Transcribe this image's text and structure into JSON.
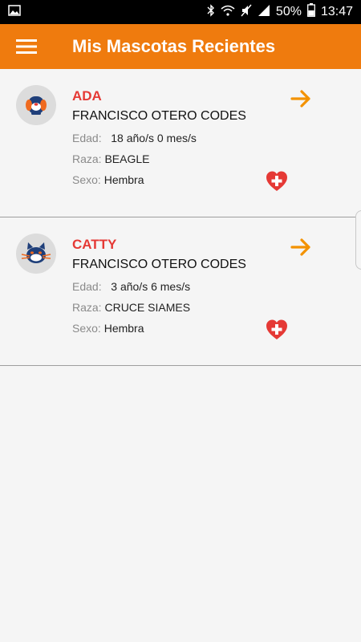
{
  "status_bar": {
    "battery_percent": "50%",
    "time": "13:47",
    "icons": [
      "image-icon",
      "bluetooth-icon",
      "wifi-icon",
      "mute-icon",
      "signal-icon",
      "battery-icon"
    ]
  },
  "app_bar": {
    "title": "Mis Mascotas Recientes",
    "menu_icon": "hamburger-menu-icon",
    "color": "#ef7b0e"
  },
  "labels": {
    "edad": "Edad:",
    "raza": "Raza:",
    "sexo": "Sexo:"
  },
  "pets": [
    {
      "name": "ADA",
      "owner": "FRANCISCO OTERO CODES",
      "edad": "18 año/s 0 mes/s",
      "raza": "BEAGLE",
      "sexo": "Hembra",
      "avatar_icon": "dog-icon"
    },
    {
      "name": "CATTY",
      "owner": "FRANCISCO OTERO CODES",
      "edad": "3 año/s 6 mes/s",
      "raza": "CRUCE SIAMES",
      "sexo": "Hembra",
      "avatar_icon": "cat-icon"
    }
  ],
  "colors": {
    "pet_name": "#e53935",
    "arrow": "#f39200",
    "health": "#e53935"
  }
}
